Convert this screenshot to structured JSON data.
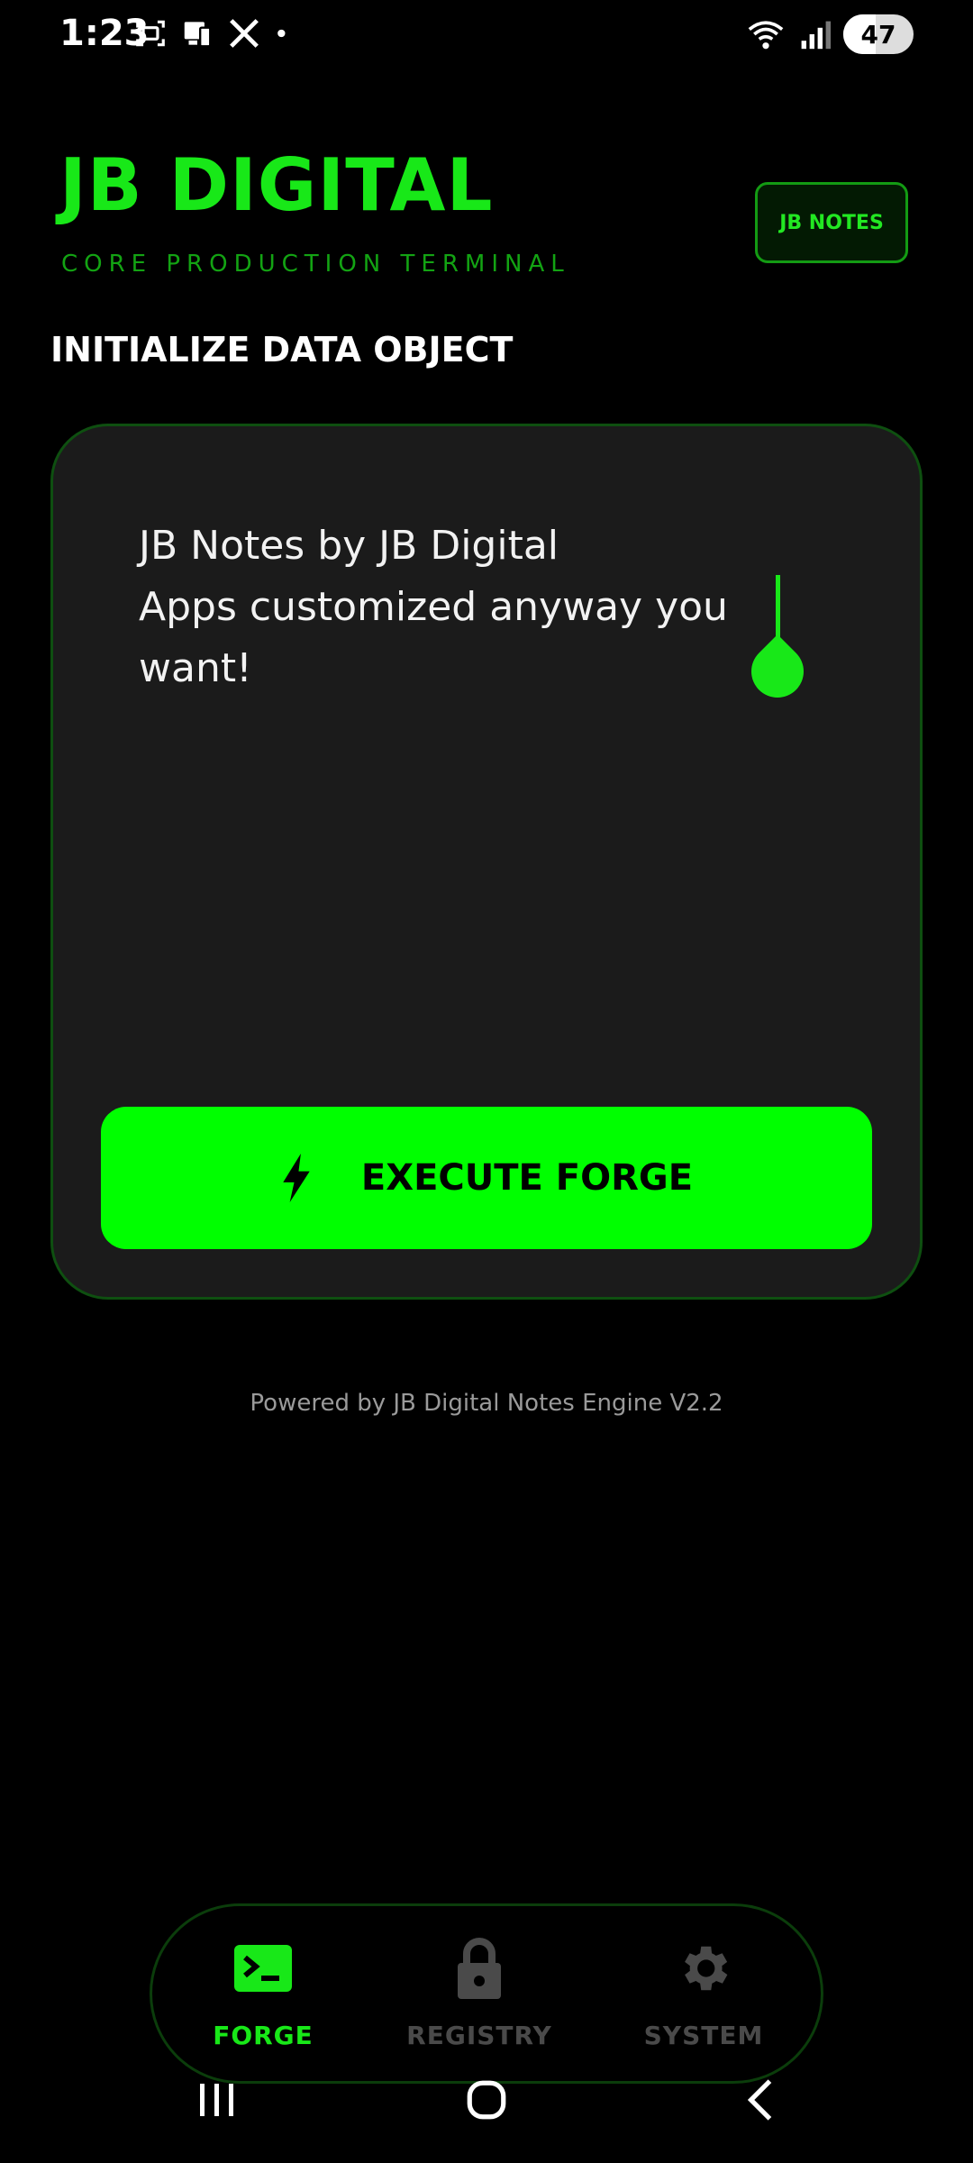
{
  "status_bar": {
    "time": "1:23",
    "battery": "47"
  },
  "header": {
    "brand": "JB DIGITAL",
    "tagline": "CORE PRODUCTION TERMINAL",
    "notes_button": "JB NOTES"
  },
  "section_title": "INITIALIZE DATA OBJECT",
  "note_input": {
    "value": "JB Notes by JB Digital\nApps customized anyway you want!"
  },
  "execute_button": "EXECUTE FORGE",
  "footer": "Powered by JB Digital Notes Engine V2.2",
  "bottom_nav": {
    "items": [
      {
        "label": "FORGE",
        "icon": "terminal-icon",
        "active": true
      },
      {
        "label": "REGISTRY",
        "icon": "lock-icon",
        "active": false
      },
      {
        "label": "SYSTEM",
        "icon": "gear-icon",
        "active": false
      }
    ]
  },
  "colors": {
    "accent": "#00ff00",
    "brand": "#18e818",
    "card": "#1b1b1b",
    "inactive": "#4a4a4a"
  }
}
